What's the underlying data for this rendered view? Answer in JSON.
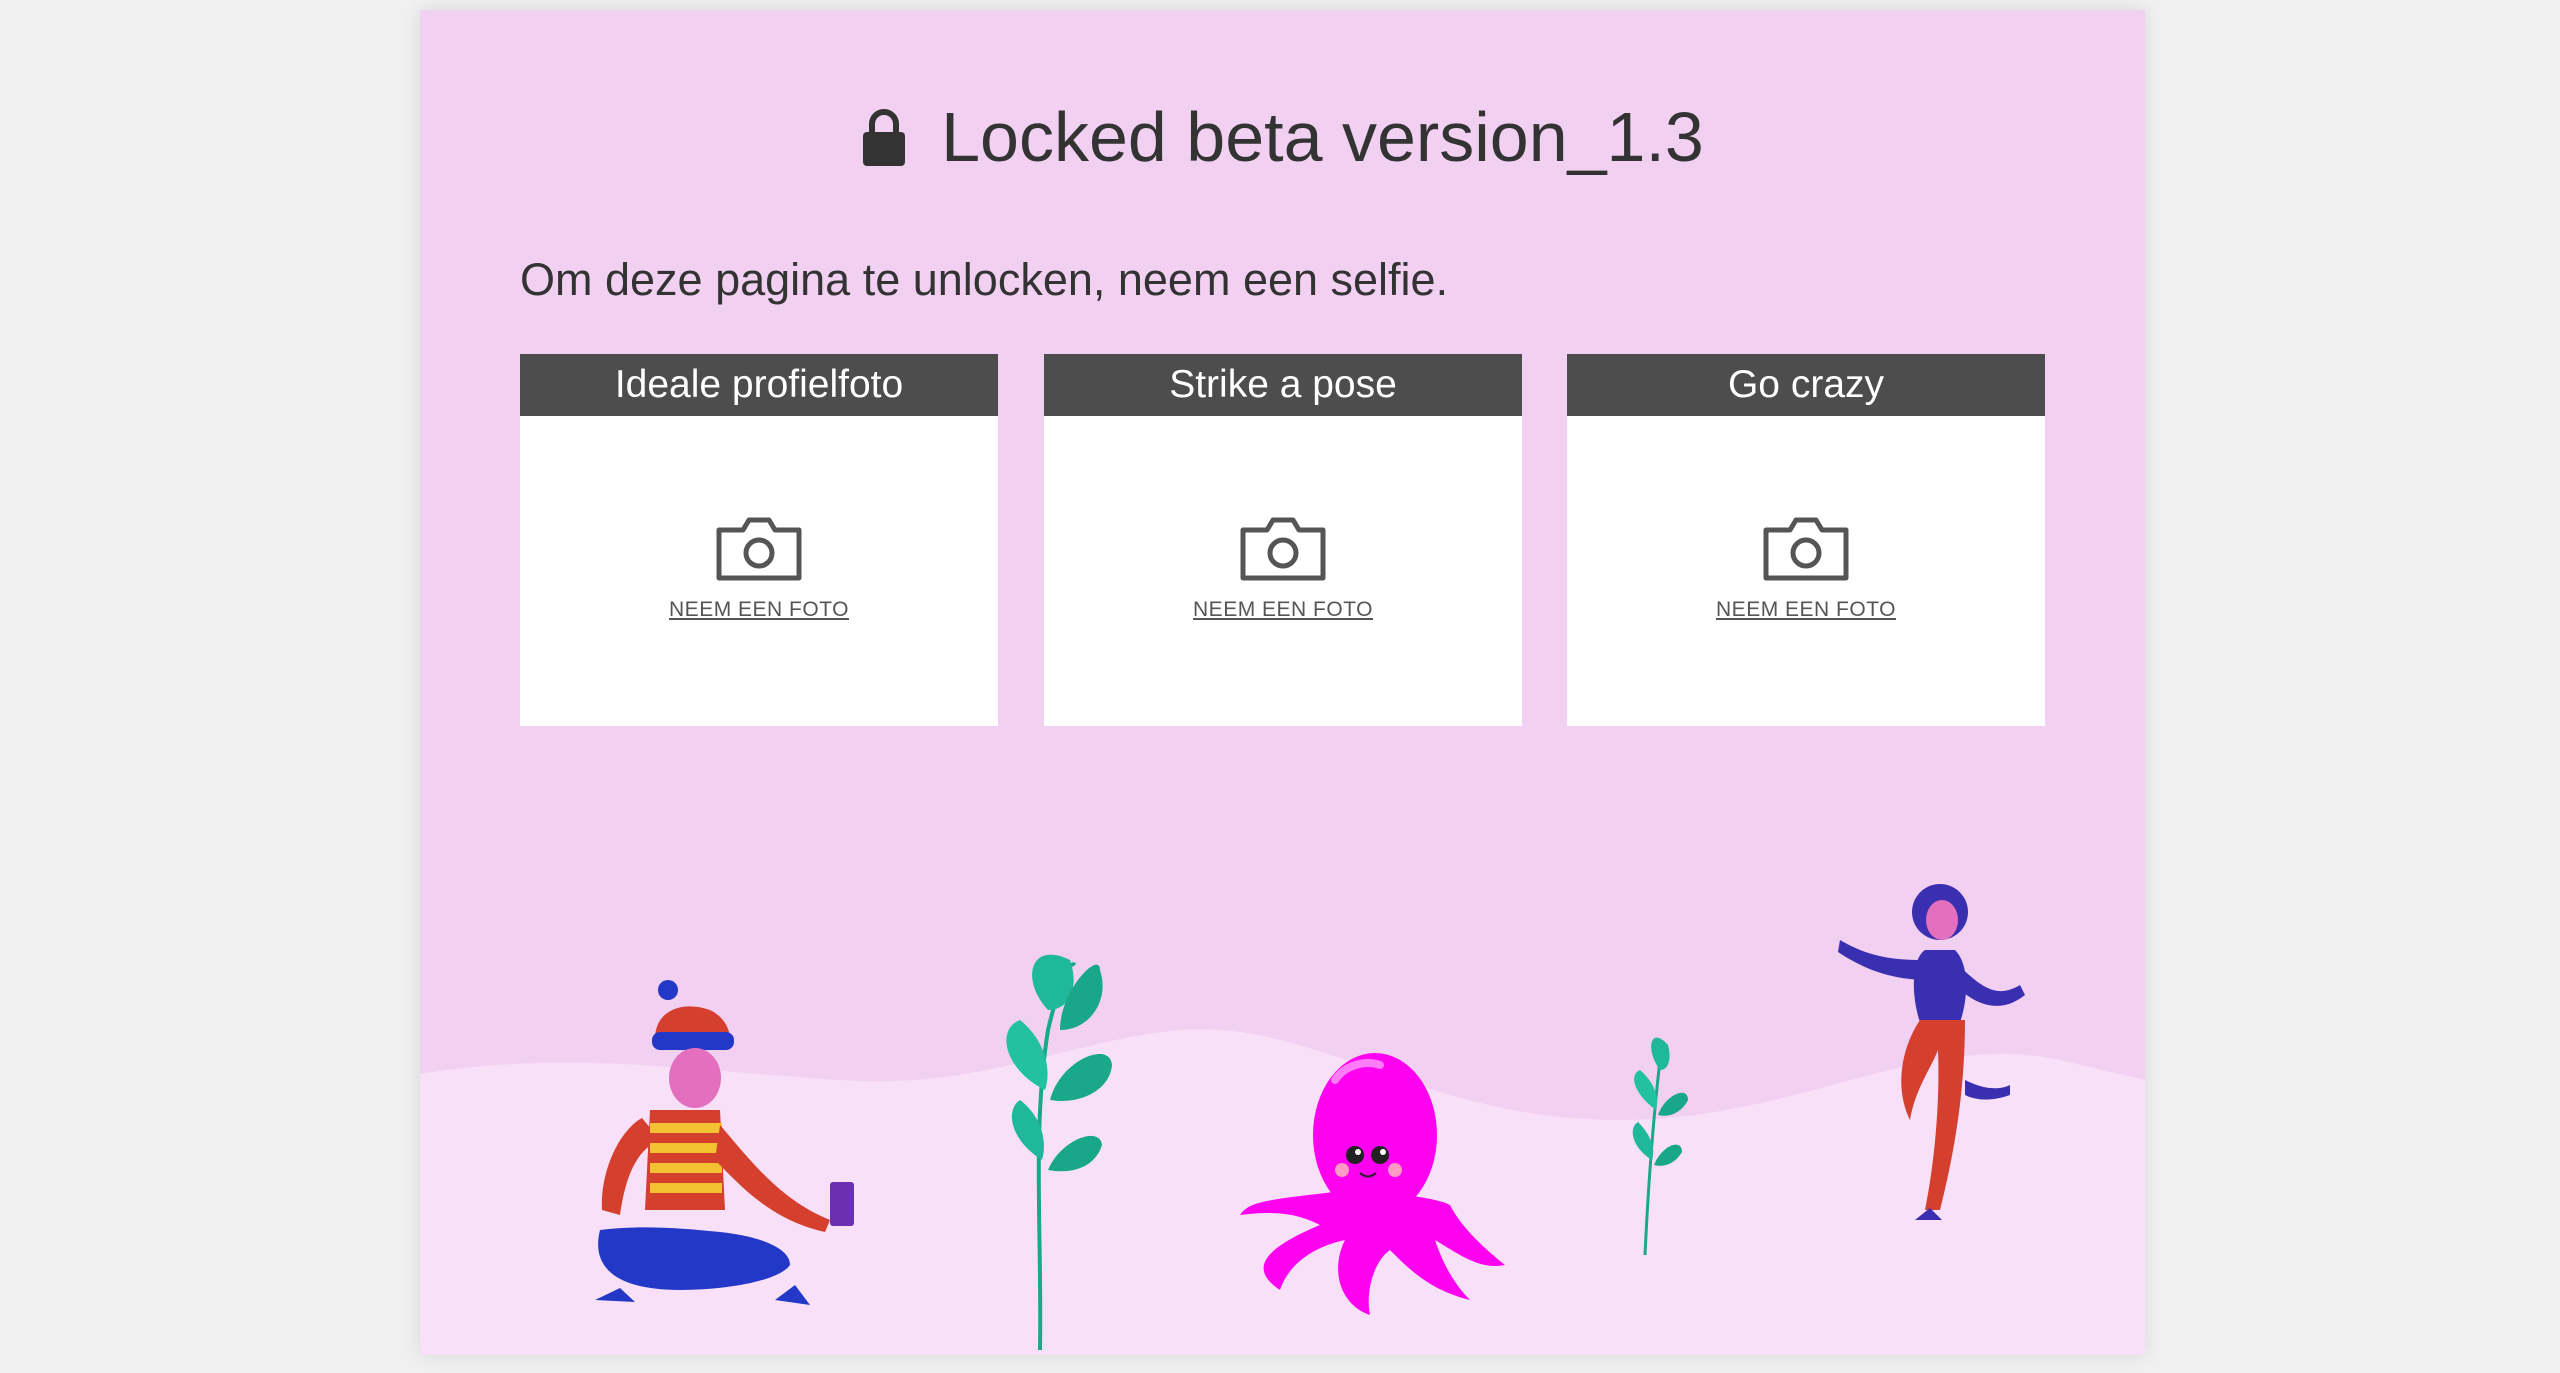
{
  "header": {
    "lock_icon": "lock-icon",
    "title": "Locked beta version_1.3"
  },
  "main": {
    "instruction": "Om deze pagina te unlocken, neem een selfie.",
    "cards": [
      {
        "title": "Ideale profielfoto",
        "icon": "camera-icon",
        "action_label": "NEEM EEN FOTO"
      },
      {
        "title": "Strike a pose",
        "icon": "camera-icon",
        "action_label": "NEEM EEN FOTO"
      },
      {
        "title": "Go crazy",
        "icon": "camera-icon",
        "action_label": "NEEM EEN FOTO"
      }
    ]
  },
  "colors": {
    "page_bg": "#f0f0f0",
    "panel_bg": "#f2d0f2",
    "hill": "#f8e1f8",
    "card_header": "#4d4d4d",
    "text": "#333333",
    "octopus": "#ff00f0",
    "leaf": "#1fb89a"
  }
}
